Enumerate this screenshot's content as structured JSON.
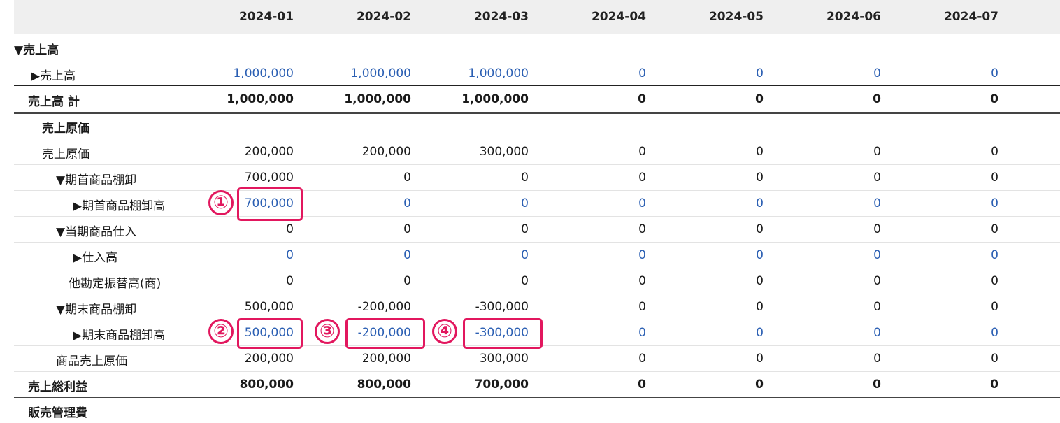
{
  "columns": [
    "2024-01",
    "2024-02",
    "2024-03",
    "2024-04",
    "2024-05",
    "2024-06",
    "2024-07"
  ],
  "rows": [
    {
      "label": "▼売上高",
      "bold": true,
      "values": []
    },
    {
      "label": "▶売上高",
      "link": true,
      "values": [
        "1,000,000",
        "1,000,000",
        "1,000,000",
        "0",
        "0",
        "0",
        "0"
      ]
    },
    {
      "label": "売上高 計",
      "bold": true,
      "values": [
        "1,000,000",
        "1,000,000",
        "1,000,000",
        "0",
        "0",
        "0",
        "0"
      ]
    },
    {
      "label": "売上原価",
      "bold": true,
      "values": []
    },
    {
      "label": "売上原価",
      "values": [
        "200,000",
        "200,000",
        "300,000",
        "0",
        "0",
        "0",
        "0"
      ]
    },
    {
      "label": "▼期首商品棚卸",
      "values": [
        "700,000",
        "0",
        "0",
        "0",
        "0",
        "0",
        "0"
      ]
    },
    {
      "label": "▶期首商品棚卸高",
      "link": true,
      "values": [
        "700,000",
        "0",
        "0",
        "0",
        "0",
        "0",
        "0"
      ]
    },
    {
      "label": "▼当期商品仕入",
      "values": [
        "0",
        "0",
        "0",
        "0",
        "0",
        "0",
        "0"
      ]
    },
    {
      "label": "▶仕入高",
      "link": true,
      "values": [
        "0",
        "0",
        "0",
        "0",
        "0",
        "0",
        "0"
      ]
    },
    {
      "label": "他勘定振替高(商)",
      "values": [
        "0",
        "0",
        "0",
        "0",
        "0",
        "0",
        "0"
      ]
    },
    {
      "label": "▼期末商品棚卸",
      "values": [
        "500,000",
        "-200,000",
        "-300,000",
        "0",
        "0",
        "0",
        "0"
      ]
    },
    {
      "label": "▶期末商品棚卸高",
      "link": true,
      "values": [
        "500,000",
        "-200,000",
        "-300,000",
        "0",
        "0",
        "0",
        "0"
      ]
    },
    {
      "label": "商品売上原価",
      "values": [
        "200,000",
        "200,000",
        "300,000",
        "0",
        "0",
        "0",
        "0"
      ]
    },
    {
      "label": "売上総利益",
      "bold": true,
      "values": [
        "800,000",
        "800,000",
        "700,000",
        "0",
        "0",
        "0",
        "0"
      ]
    },
    {
      "label": "販売管理費",
      "bold": true,
      "values": []
    }
  ],
  "callouts": [
    "①",
    "②",
    "③",
    "④"
  ]
}
